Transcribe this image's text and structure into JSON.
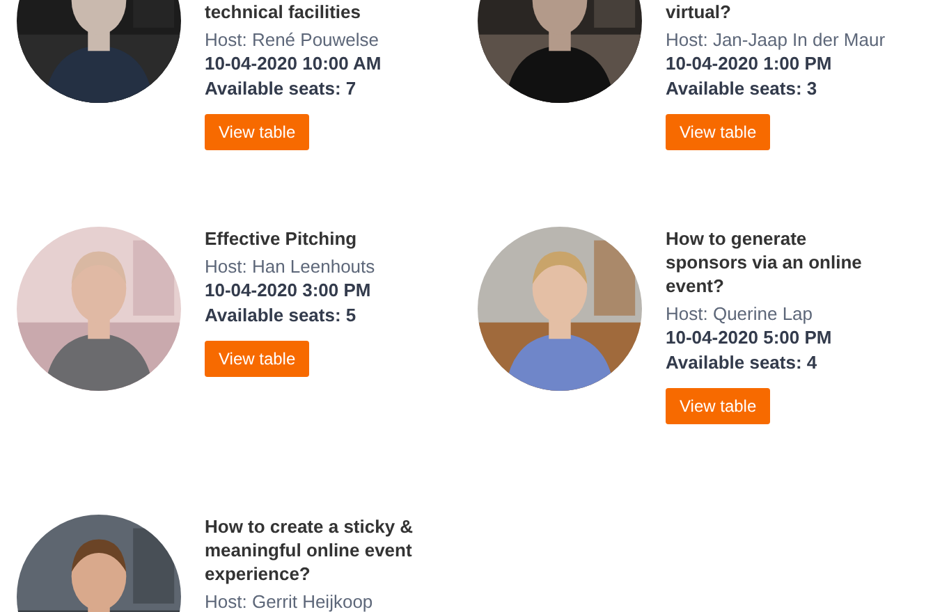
{
  "sessions": [
    {
      "title": "technical facilities",
      "host": "Host: René Pouwelse",
      "datetime": "10-04-2020 10:00 AM",
      "seats": "Available seats: 7",
      "button": "View table"
    },
    {
      "title": "virtual?",
      "host": "Host: Jan-Jaap In der Maur",
      "datetime": "10-04-2020 1:00 PM",
      "seats": "Available seats: 3",
      "button": "View table"
    },
    {
      "title": "Effective Pitching",
      "host": "Host: Han Leenhouts",
      "datetime": "10-04-2020 3:00 PM",
      "seats": "Available seats: 5",
      "button": "View table"
    },
    {
      "title": "How to generate sponsors via an online event?",
      "host": "Host: Querine Lap",
      "datetime": "10-04-2020 5:00 PM",
      "seats": "Available seats: 4",
      "button": "View table"
    },
    {
      "title": "How to create a sticky & meaningful online event experience?",
      "host": "Host: Gerrit Heijkoop"
    }
  ]
}
